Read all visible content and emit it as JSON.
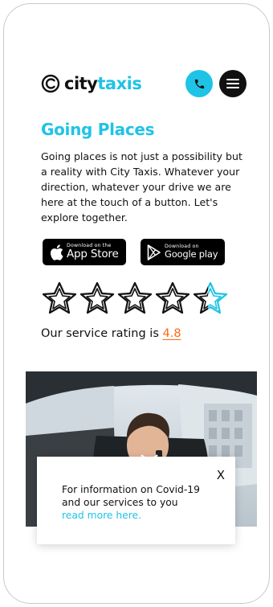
{
  "brand": {
    "name_part1": "city",
    "name_part2": "taxis",
    "accent_color": "#1fc3e6",
    "secondary_color": "#ff6a13"
  },
  "header": {
    "call_icon": "phone-icon",
    "menu_icon": "hamburger-menu-icon"
  },
  "hero": {
    "title": "Going Places",
    "description": "Going places is not just a possibility but a reality with City Taxis. Whatever your direction, whatever your drive we are here at the touch of a button. Let's explore together."
  },
  "badges": {
    "apple_small": "Download on the",
    "apple_big": "App Store",
    "google_small": "Download on",
    "google_big": "Google play"
  },
  "rating": {
    "stars_total": 5,
    "value": 4.8,
    "label": "Our service rating is",
    "value_text": "4.8"
  },
  "popup": {
    "close_label": "X",
    "text": "For information on Covid-19 and our services to you",
    "link_text": "read more here."
  }
}
